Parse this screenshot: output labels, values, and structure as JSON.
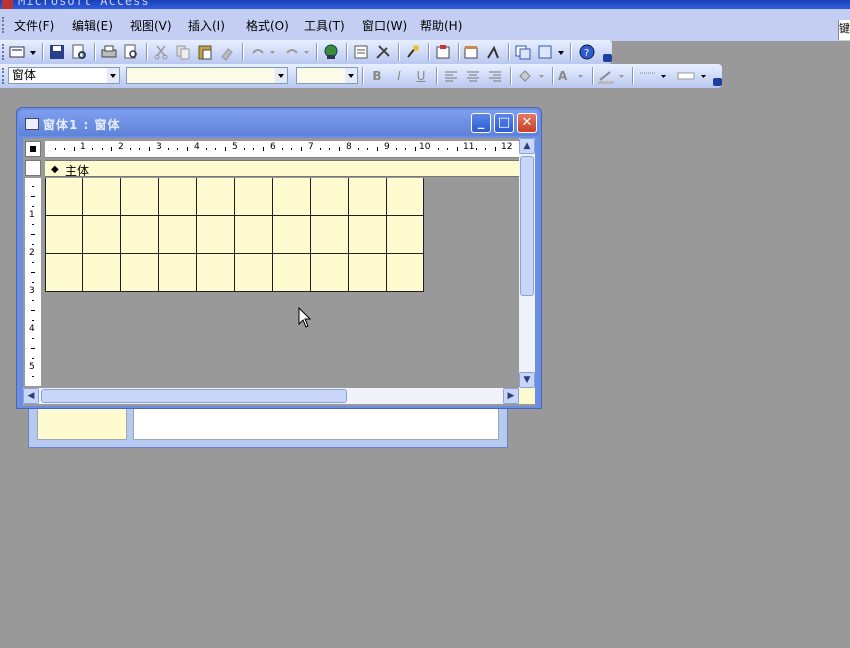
{
  "app": {
    "title": "Microsoft Access"
  },
  "menu": {
    "items": [
      "文件(F)",
      "编辑(E)",
      "视图(V)",
      "插入(I)",
      "格式(O)",
      "工具(T)",
      "窗口(W)",
      "帮助(H)"
    ],
    "right_stub": "键"
  },
  "toolbar_format": {
    "object_combo": "窗体",
    "font_combo": "",
    "size_combo": "",
    "bold_label": "B",
    "italic_label": "I",
    "underline_label": "U",
    "font_color_label": "A"
  },
  "form_window": {
    "title": "窗体1 : 窗体",
    "section_label": "主体",
    "ruler_numbers": [
      "1",
      "2",
      "3",
      "4",
      "5",
      "6",
      "7",
      "8",
      "9",
      "10",
      "11",
      "12"
    ],
    "vruler_numbers": [
      "1",
      "2",
      "3",
      "4",
      "5"
    ],
    "grid": {
      "columns": 10,
      "rows": 3,
      "background": "#fffbd0"
    }
  },
  "colors": {
    "workspace": "#999999",
    "menubar": "#c4cef2",
    "window_frame": "#6c8ee0",
    "section_fill": "#fffbd0"
  }
}
